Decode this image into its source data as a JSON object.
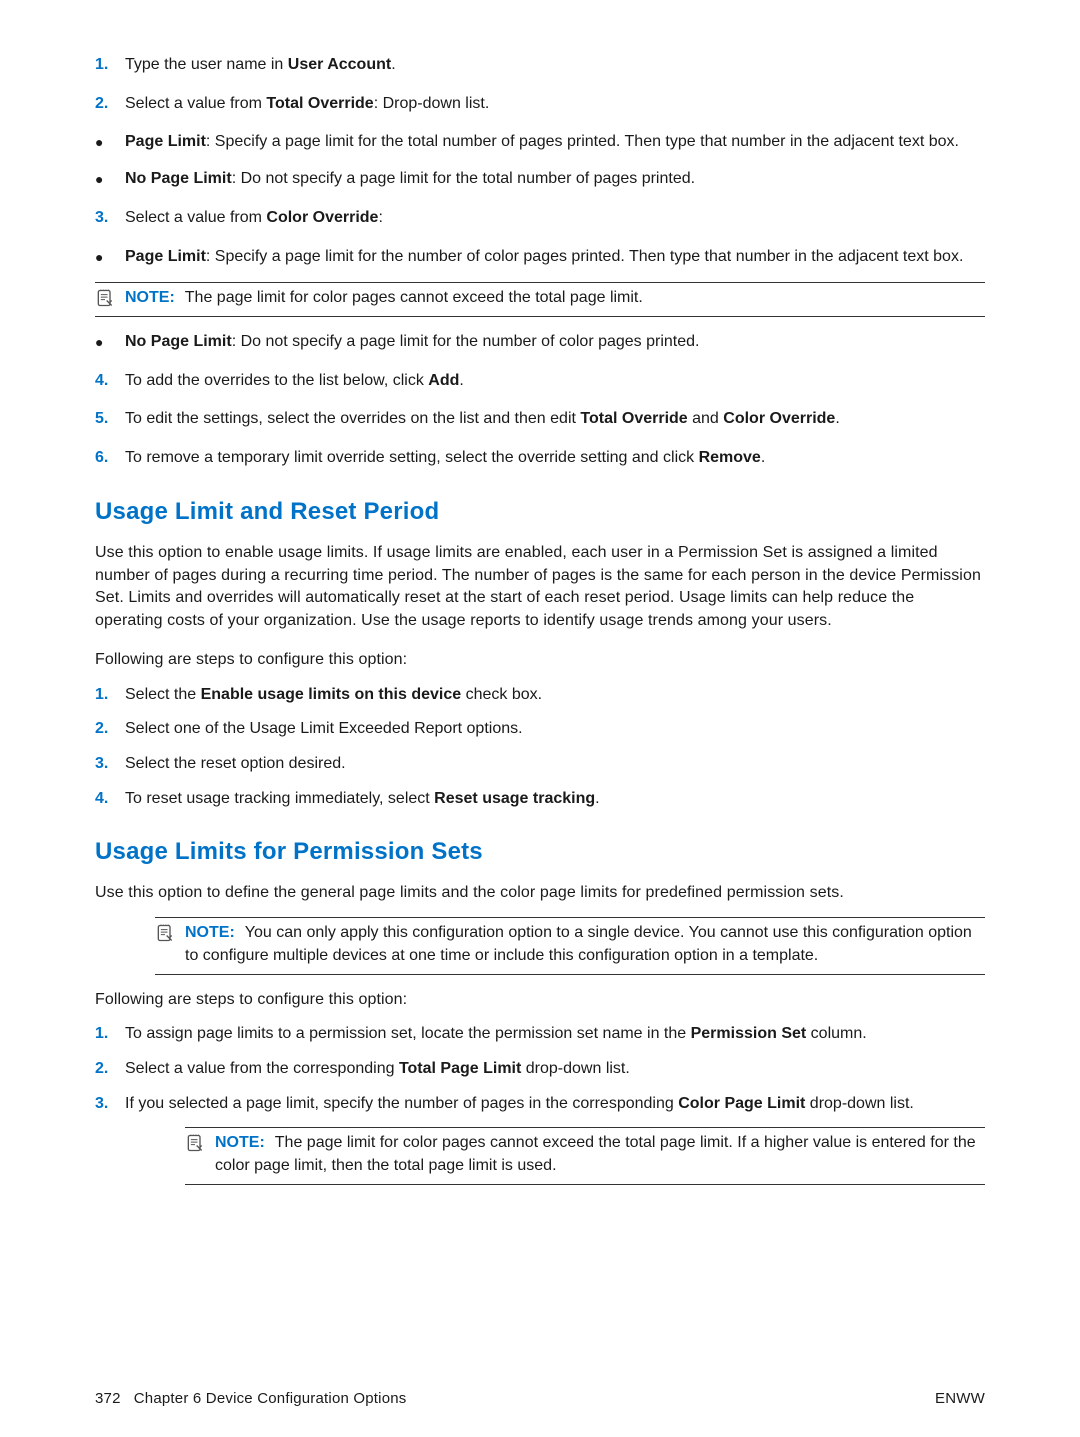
{
  "steps_a": [
    {
      "num": "1.",
      "parts": [
        "Type the user name in ",
        "User Account",
        "."
      ]
    },
    {
      "num": "2.",
      "parts": [
        "Select a value from ",
        "Total Override",
        ": Drop-down list."
      ]
    }
  ],
  "bullets_a": [
    {
      "bold": "Page Limit",
      "text": ": Specify a page limit for the total number of pages printed. Then type that number in the adjacent text box."
    },
    {
      "bold": "No Page Limit",
      "text": ": Do not specify a page limit for the total number of pages printed."
    }
  ],
  "step3": {
    "num": "3.",
    "parts": [
      "Select a value from ",
      "Color Override",
      ":"
    ]
  },
  "bullets_b_first": {
    "bold": "Page Limit",
    "text": ": Specify a page limit for the number of color pages printed. Then type that number in the adjacent text box."
  },
  "note1": {
    "label": "NOTE:",
    "text": "The page limit for color pages cannot exceed the total page limit."
  },
  "bullets_b_second": {
    "bold": "No Page Limit",
    "text": ": Do not specify a page limit for the number of color pages printed."
  },
  "step4": {
    "num": "4.",
    "parts": [
      "To add the overrides to the list below, click ",
      "Add",
      "."
    ]
  },
  "step5": {
    "num": "5.",
    "parts": [
      "To edit the settings, select the overrides on the list and then edit ",
      "Total Override",
      " and ",
      "Color Override",
      "."
    ]
  },
  "step6": {
    "num": "6.",
    "parts": [
      "To remove a temporary limit override setting, select the override setting and click ",
      "Remove",
      "."
    ]
  },
  "section1": {
    "heading": "Usage Limit and Reset Period",
    "intro": "Use this option to enable usage limits. If usage limits are enabled, each user in a Permission Set is assigned a limited number of pages during a recurring time period. The number of pages is the same for each person in the device Permission Set. Limits and overrides will automatically reset at the start of each reset period. Usage limits can help reduce the operating costs of your organization. Use the usage reports to identify usage trends among your users.",
    "following": "Following are steps to configure this option:",
    "steps": [
      {
        "num": "1.",
        "parts": [
          "Select the ",
          "Enable usage limits on this device",
          " check box."
        ]
      },
      {
        "num": "2.",
        "plain": "Select one of the Usage Limit Exceeded Report options."
      },
      {
        "num": "3.",
        "plain": "Select the reset option desired."
      },
      {
        "num": "4.",
        "parts": [
          "To reset usage tracking immediately, select ",
          "Reset usage tracking",
          "."
        ]
      }
    ]
  },
  "section2": {
    "heading": "Usage Limits for Permission Sets",
    "intro": "Use this option to define the general page limits and the color page limits for predefined permission sets.",
    "note": {
      "label": "NOTE:",
      "text": "You can only apply this configuration option to a single device. You cannot use this configuration option to configure multiple devices at one time or include this configuration option in a template."
    },
    "following": "Following are steps to configure this option:",
    "steps": [
      {
        "num": "1.",
        "parts": [
          "To assign page limits to a permission set, locate the permission set name in the ",
          "Permission Set",
          " column."
        ]
      },
      {
        "num": "2.",
        "parts": [
          "Select a value from the corresponding ",
          "Total Page Limit",
          " drop-down list."
        ]
      },
      {
        "num": "3.",
        "parts": [
          "If you selected a page limit, specify the number of pages in the corresponding ",
          "Color Page Limit",
          " drop-down list."
        ]
      }
    ],
    "note2": {
      "label": "NOTE:",
      "text": "The page limit for color pages cannot exceed the total page limit. If a higher value is entered for the color page limit, then the total page limit is used."
    }
  },
  "footer": {
    "left_page": "372",
    "left_text": "Chapter 6   Device Configuration Options",
    "right": "ENWW"
  }
}
